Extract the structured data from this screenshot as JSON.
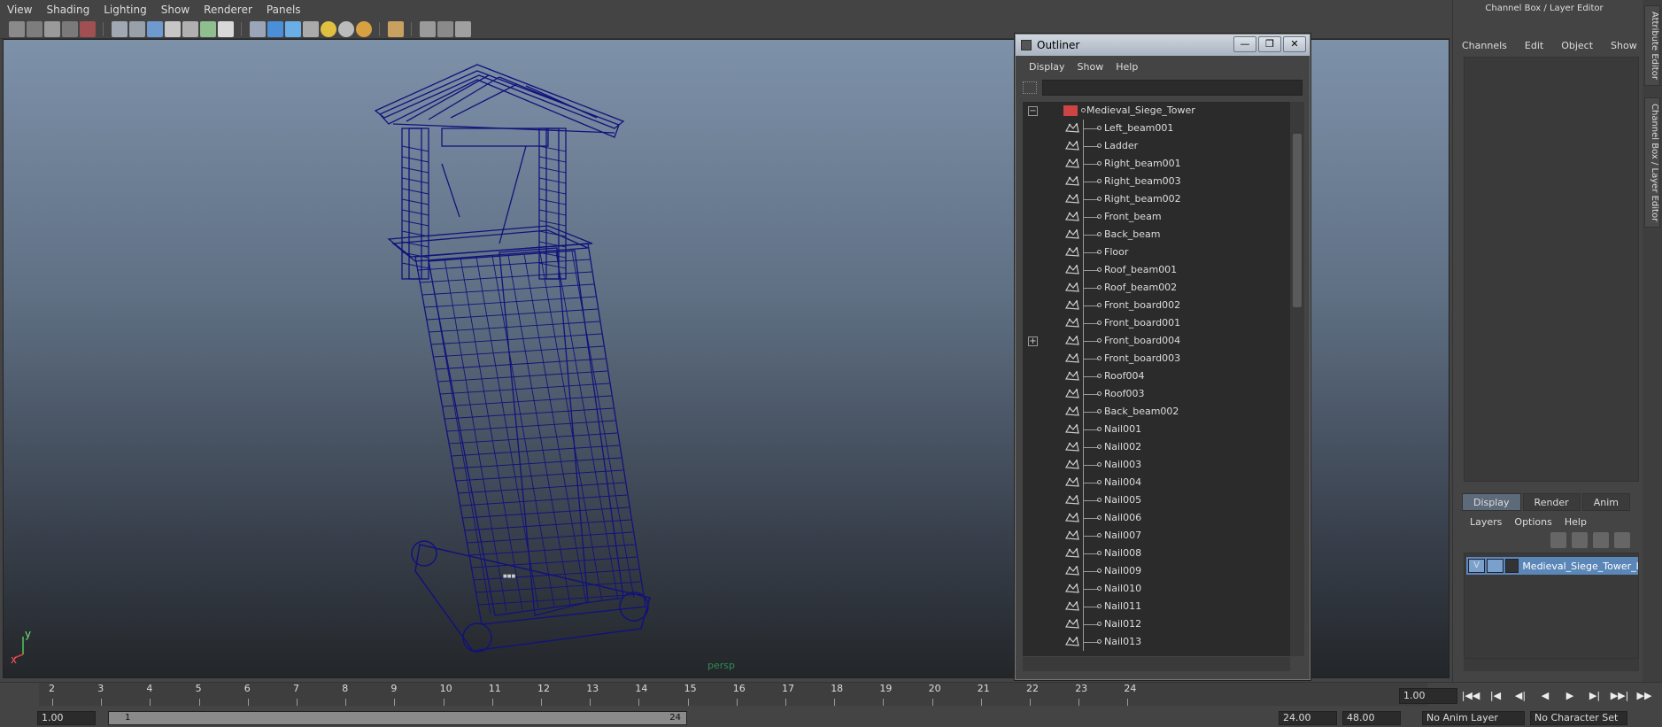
{
  "menubar": [
    "View",
    "Shading",
    "Lighting",
    "Show",
    "Renderer",
    "Panels"
  ],
  "viewport": {
    "camera_label": "persp",
    "axis": {
      "x": "x",
      "y": "y"
    }
  },
  "outliner": {
    "title": "Outliner",
    "window_buttons": [
      "—",
      "❐",
      "✕"
    ],
    "menu": [
      "Display",
      "Show",
      "Help"
    ],
    "search_value": "",
    "root": "Medieval_Siege_Tower",
    "items": [
      "Left_beam001",
      "Ladder",
      "Right_beam001",
      "Right_beam003",
      "Right_beam002",
      "Front_beam",
      "Back_beam",
      "Floor",
      "Roof_beam001",
      "Roof_beam002",
      "Front_board002",
      "Front_board001",
      "Front_board004",
      "Front_board003",
      "Roof004",
      "Roof003",
      "Back_beam002",
      "Nail001",
      "Nail002",
      "Nail003",
      "Nail004",
      "Nail005",
      "Nail006",
      "Nail007",
      "Nail008",
      "Nail009",
      "Nail010",
      "Nail011",
      "Nail012",
      "Nail013"
    ]
  },
  "right_panel": {
    "title": "Channel Box / Layer Editor",
    "channel_menu": [
      "Channels",
      "Edit",
      "Object",
      "Show"
    ],
    "side_tabs": [
      "Attribute Editor",
      "Channel Box / Layer Editor"
    ],
    "layer_tabs": [
      "Display",
      "Render",
      "Anim"
    ],
    "layer_menu": [
      "Layers",
      "Options",
      "Help"
    ],
    "layer": {
      "visible": "V",
      "name": "Medieval_Siege_Tower_la"
    }
  },
  "timeline": {
    "ticks": [
      "2",
      "3",
      "4",
      "5",
      "6",
      "7",
      "8",
      "9",
      "10",
      "11",
      "12",
      "13",
      "14",
      "15",
      "16",
      "17",
      "18",
      "19",
      "20",
      "21",
      "22",
      "23",
      "24"
    ],
    "current_frame": "1.00",
    "play_buttons": [
      "|◀◀",
      "|◀",
      "◀|",
      "◀",
      "▶",
      "▶|",
      "▶▶|",
      "▶▶"
    ]
  },
  "range": {
    "start": "1.00",
    "inner_start": "1",
    "inner_end": "24",
    "end": "24.00",
    "anim_end": "48.00",
    "anim_layer": "No Anim Layer",
    "character_set": "No Character Set"
  }
}
